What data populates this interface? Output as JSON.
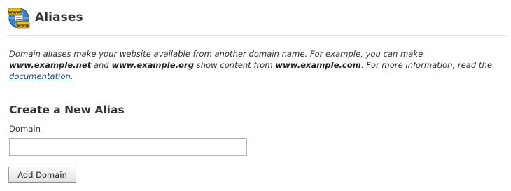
{
  "header": {
    "title": "Aliases",
    "icon": "www-globe-icon",
    "icon_text": "www"
  },
  "description": {
    "part1": "Domain aliases make your website available from another domain name. For example, you can make ",
    "example1": "www.example.net",
    "part2": " and ",
    "example2": "www.example.org",
    "part3": " show content from ",
    "example3": "www.example.com",
    "part4": ". For more information, read the ",
    "link_text": "documentation",
    "part5": "."
  },
  "form": {
    "section_title": "Create a New Alias",
    "domain_label": "Domain",
    "domain_value": "",
    "domain_placeholder": "",
    "submit_label": "Add Domain"
  },
  "colors": {
    "link": "#1d4a85",
    "globe": "#3a7fc4",
    "banner": "#f2c200"
  }
}
